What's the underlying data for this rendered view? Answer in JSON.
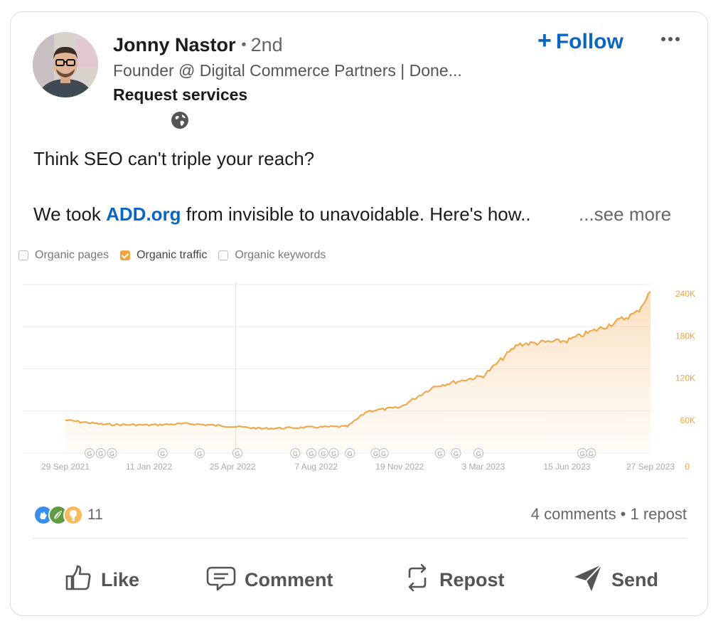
{
  "author": {
    "name": "Jonny Nastor",
    "connection": "2nd",
    "separator": "•",
    "headline": "Founder @ Digital Commerce Partners | Done...",
    "request": "Request services"
  },
  "follow_label": "Follow",
  "follow_icon": "plus-icon",
  "more_icon": "ellipsis-icon",
  "visibility_icon": "globe-icon",
  "post": {
    "line1": "Think SEO can't triple your reach?",
    "line2_before": "We took ",
    "link": "ADD.org",
    "line2_after": " from invisible to unavoidable. Here's how..",
    "see_more": "...see more"
  },
  "colors": {
    "accent": "#0a66c2",
    "chart_line": "#f0a441"
  },
  "chart_data": {
    "type": "area",
    "legend": [
      {
        "label": "Organic pages",
        "checked": false
      },
      {
        "label": "Organic traffic",
        "checked": true
      },
      {
        "label": "Organic keywords",
        "checked": false
      }
    ],
    "x_ticks": [
      "29 Sep 2021",
      "11 Jan 2022",
      "25 Apr 2022",
      "7 Aug 2022",
      "19 Nov 2022",
      "3 Mar 2023",
      "15 Jun 2023",
      "27 Sep 2023"
    ],
    "y_ticks": [
      "240K",
      "180K",
      "120K",
      "60K",
      "0"
    ],
    "ylim": [
      0,
      240000
    ],
    "grid": true,
    "series": [
      {
        "name": "Organic traffic",
        "x": [
          "29 Sep 2021",
          "15 Nov 2021",
          "11 Jan 2022",
          "1 Mar 2022",
          "25 Apr 2022",
          "1 Jun 2022",
          "7 Aug 2022",
          "15 Sep 2022",
          "10 Oct 2022",
          "19 Nov 2022",
          "1 Jan 2023",
          "3 Mar 2023",
          "15 Apr 2023",
          "15 Jun 2023",
          "1 Aug 2023",
          "10 Sep 2023",
          "27 Sep 2023"
        ],
        "values": [
          47000,
          41000,
          40000,
          42000,
          38000,
          35000,
          37000,
          38000,
          60000,
          65000,
          95000,
          110000,
          155000,
          160000,
          180000,
          200000,
          230000
        ]
      }
    ],
    "annotation_markers": [
      "29 Oct 2021",
      "12 Nov 2021",
      "26 Nov 2021",
      "28 Jan 2022",
      "15 Mar 2022",
      "1 May 2022",
      "12 Jul 2022",
      "1 Aug 2022",
      "16 Aug 2022",
      "29 Aug 2022",
      "18 Sep 2022",
      "20 Oct 2022",
      "30 Oct 2022",
      "8 Jan 2023",
      "28 Jan 2023",
      "25 Feb 2023",
      "4 Jul 2023",
      "15 Jul 2023"
    ],
    "marker_label": "G",
    "vertical_marker": "29 Apr 2022"
  },
  "social": {
    "reaction_icons": [
      "clap-icon",
      "support-icon",
      "insightful-icon"
    ],
    "reaction_count": "11",
    "comments_reposts": "4 comments • 1 repost"
  },
  "actions": {
    "like": "Like",
    "comment": "Comment",
    "repost": "Repost",
    "send": "Send"
  }
}
